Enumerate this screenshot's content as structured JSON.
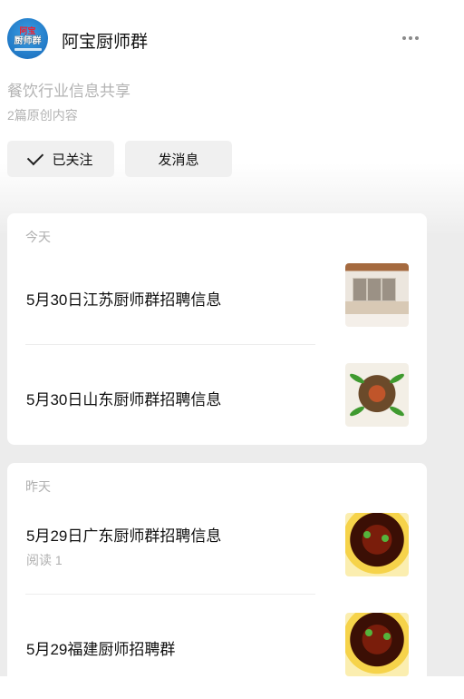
{
  "header": {
    "avatar_top": "阿宝",
    "avatar_text": "厨师群",
    "title": "阿宝厨师群",
    "more_icon": "more-dots-icon"
  },
  "profile": {
    "description": "餐饮行业信息共享",
    "article_count": "2篇原创内容"
  },
  "buttons": {
    "follow_label": "已关注",
    "message_label": "发消息"
  },
  "sections": [
    {
      "day": "今天",
      "articles": [
        {
          "title": "5月30日江苏厨师群招聘信息",
          "read": ""
        },
        {
          "title": "5月30日山东厨师群招聘信息",
          "read": ""
        }
      ]
    },
    {
      "day": "昨天",
      "articles": [
        {
          "title": "5月29日广东厨师群招聘信息",
          "read": "阅读 1"
        },
        {
          "title": "5月29福建厨师招聘群",
          "read": ""
        }
      ]
    }
  ]
}
